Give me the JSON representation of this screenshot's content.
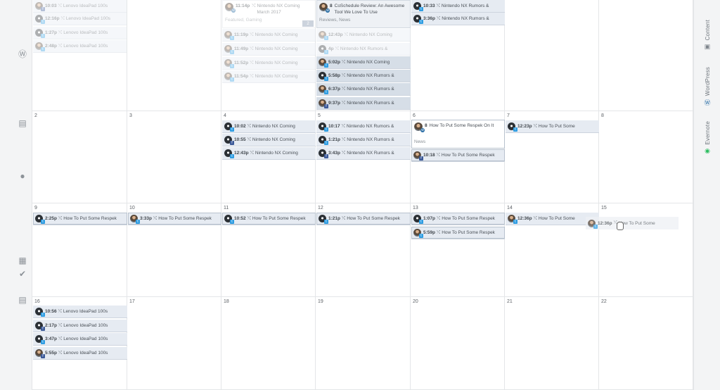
{
  "right_rail": [
    {
      "label": "Content",
      "icon": "content-icon"
    },
    {
      "label": "WordPress",
      "icon": "wordpress-icon"
    },
    {
      "label": "Evernote",
      "icon": "evernote-icon"
    }
  ],
  "left_rail_icons": [
    "wordpress-icon",
    "document-icon",
    "comment-icon",
    "calendar-icon",
    "check-icon",
    "list-icon"
  ],
  "week_numbers": {
    "w2": [
      "2",
      "3",
      "4",
      "5",
      "6",
      "7",
      "8"
    ],
    "w3": [
      "9",
      "10",
      "11",
      "12",
      "13",
      "14",
      "15"
    ],
    "w4": [
      "16",
      "17",
      "18",
      "19",
      "20",
      "21",
      "22"
    ]
  },
  "events": {
    "w1_c0": [
      {
        "time": "10:03",
        "title": "Lenovo IdeaPad 100s"
      },
      {
        "time": "12:16p",
        "title": "Lenovo IdeaPad 100s"
      },
      {
        "time": "1:27p",
        "title": "Lenovo IdeaPad 100s"
      },
      {
        "time": "2:48p",
        "title": "Lenovo IdeaPad 100s"
      }
    ],
    "w1_c2_card": {
      "time": "11:14p",
      "title": "Nintendo NX Coming March 2017",
      "tags": "Featured, Gaming",
      "count": "2"
    },
    "w1_c2": [
      {
        "time": "11:19p",
        "title": "Nintendo NX Coming"
      },
      {
        "time": "11:49p",
        "title": "Nintendo NX Coming"
      },
      {
        "time": "11:52p",
        "title": "Nintendo NX Coming"
      },
      {
        "time": "11:54p",
        "title": "Nintendo NX Coming"
      }
    ],
    "w1_c3_card": {
      "count": "8",
      "title": "CoSchedule Review: An Awesome Tool We Love To Use",
      "tags": "Reviews, News"
    },
    "w1_c3": [
      {
        "time": "12:43p",
        "title": "Nintendo NX Coming"
      },
      {
        "time": "4p",
        "title": "Nintendo NX Rumors &"
      },
      {
        "time": "5:02p",
        "title": "Nintendo NX Coming"
      },
      {
        "time": "5:58p",
        "title": "Nintendo NX Rumors &"
      },
      {
        "time": "6:37p",
        "title": "Nintendo NX Rumors &"
      },
      {
        "time": "9:37p",
        "title": "Nintendo NX Rumors &"
      }
    ],
    "w1_c4": [
      {
        "time": "10:33",
        "title": "Nintendo NX Rumors &"
      },
      {
        "time": "3:36p",
        "title": "Nintendo NX Rumors &"
      }
    ],
    "w2_c2": [
      {
        "time": "10:02",
        "title": "Nintendo NX Coming"
      },
      {
        "time": "10:55",
        "title": "Nintendo NX Coming"
      },
      {
        "time": "12:43p",
        "title": "Nintendo NX Coming"
      }
    ],
    "w2_c3": [
      {
        "time": "10:17",
        "title": "Nintendo NX Rumors &"
      },
      {
        "time": "1:21p",
        "title": "Nintendo NX Rumors &"
      },
      {
        "time": "3:43p",
        "title": "Nintendo NX Rumors &"
      }
    ],
    "w2_c4_card": {
      "count": "8",
      "title": "How To Put Some Respek On It",
      "tags": "News"
    },
    "w2_c4": [
      {
        "time": "10:18",
        "title": "How To Put Some Respek"
      }
    ],
    "w2_c5": [
      {
        "time": "12:23p",
        "title": "How To Put Some"
      }
    ],
    "w3": [
      {
        "time": "2:25p",
        "title": "How To Put Some Respek"
      },
      {
        "time": "3:33p",
        "title": "How To Put Some Respek"
      },
      {
        "time": "10:52",
        "title": "How To Put Some Respek"
      },
      {
        "time": "1:21p",
        "title": "How To Put Some Respek"
      },
      {
        "time": "1:07p",
        "title": "How To Put Some Respek"
      },
      {
        "time": "12:36p",
        "title": "How To Put Some"
      }
    ],
    "w3_c4_extra": {
      "time": "5:59p",
      "title": "How To Put Some Respek"
    },
    "w3_drag": {
      "time": "12:36p",
      "title": "How To Put Some"
    },
    "w4_c0": [
      {
        "time": "10:56",
        "title": "Lenovo IdeaPad 100s"
      },
      {
        "time": "2:17p",
        "title": "Lenovo IdeaPad 100s"
      },
      {
        "time": "3:47p",
        "title": "Lenovo IdeaPad 100s"
      },
      {
        "time": "5:55p",
        "title": "Lenovo IdeaPad 100s"
      }
    ]
  },
  "retweet_symbol": "⤭"
}
